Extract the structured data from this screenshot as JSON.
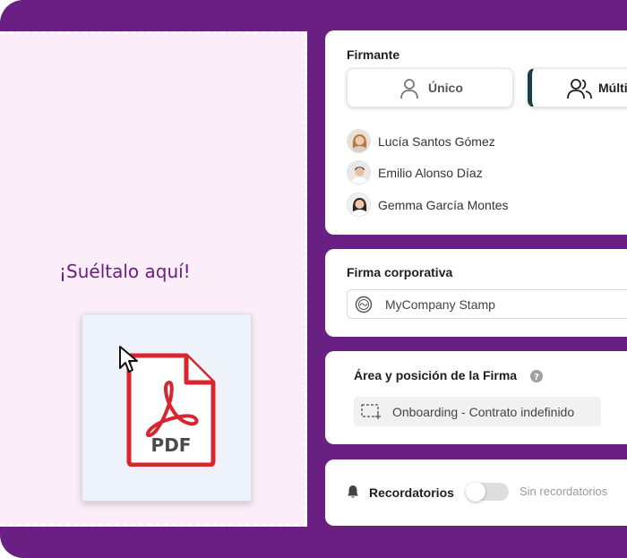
{
  "dropzone": {
    "hint": "¡Suéltalo aquí!",
    "file_label": "PDF"
  },
  "signer_section": {
    "title": "Firmante",
    "options": [
      {
        "label": "Único",
        "icon": "user-icon",
        "selected": false
      },
      {
        "label": "Múltiple",
        "icon": "users-icon",
        "selected": true
      }
    ],
    "signers": [
      {
        "name": "Lucía Santos Gómez"
      },
      {
        "name": "Emilio Alonso Díaz"
      },
      {
        "name": "Gemma García Montes"
      }
    ]
  },
  "corporate_section": {
    "title": "Firma corporativa",
    "stamp": "MyCompany Stamp"
  },
  "area_section": {
    "title": "Área y posición de la Firma",
    "value": "Onboarding - Contrato indefinido"
  },
  "reminders": {
    "title": "Recordatorios",
    "status": "Sin recordatorios",
    "enabled": false
  },
  "colors": {
    "brand": "#6a1f82",
    "dropzone_bg": "#fbeef8",
    "pdf_red": "#d9262e",
    "selected_accent": "#1c3f47"
  }
}
